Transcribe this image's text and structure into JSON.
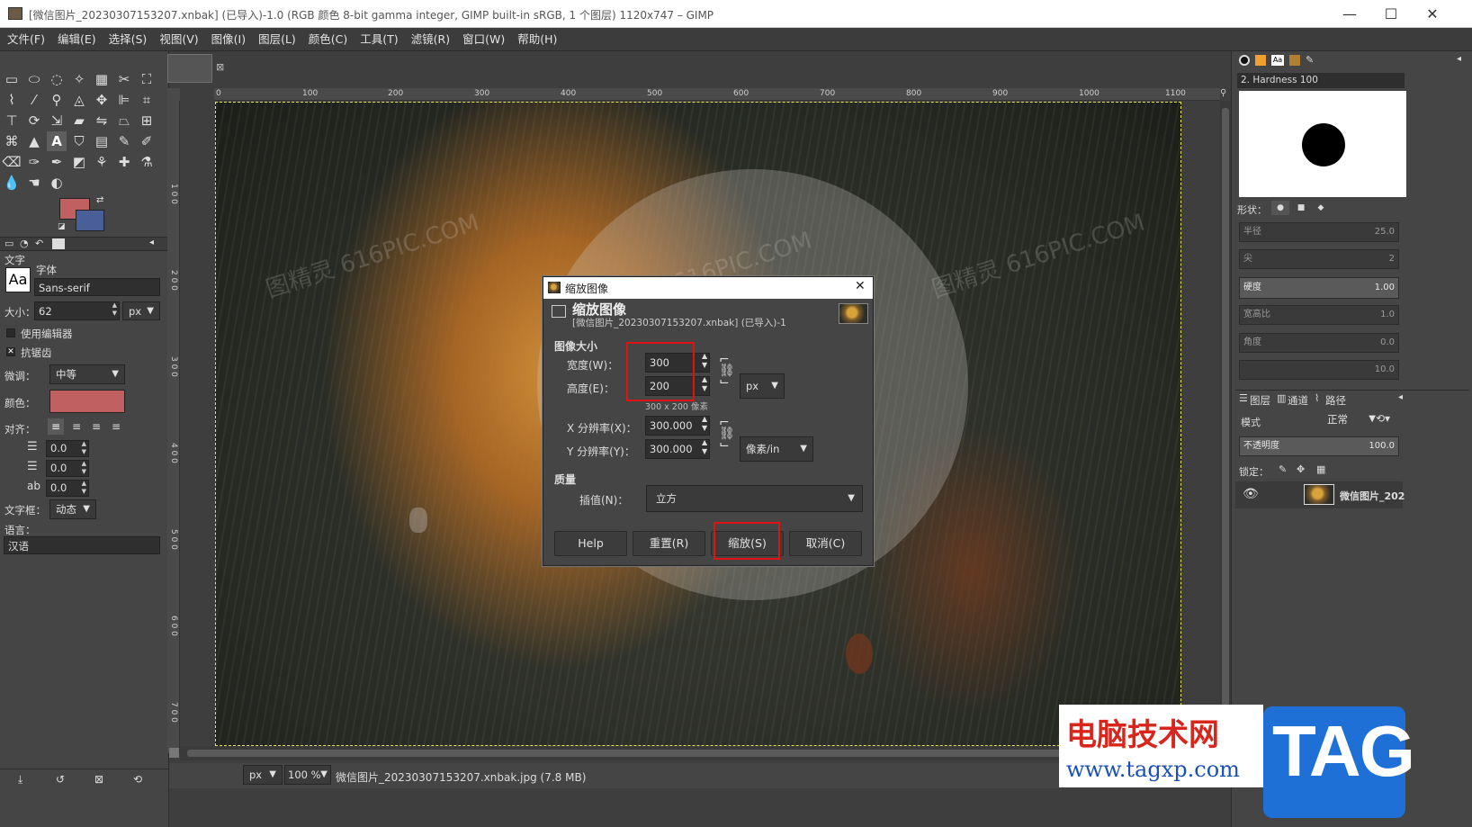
{
  "window": {
    "title": "[微信图片_20230307153207.xnbak] (已导入)-1.0 (RGB 颜色 8-bit gamma integer, GIMP built-in sRGB, 1 个图层) 1120x747 – GIMP",
    "minimize": "—",
    "maximize": "☐",
    "close": "✕"
  },
  "menu": [
    "文件(F)",
    "编辑(E)",
    "选择(S)",
    "视图(V)",
    "图像(I)",
    "图层(L)",
    "颜色(C)",
    "工具(T)",
    "滤镜(R)",
    "窗口(W)",
    "帮助(H)"
  ],
  "toolbox": {
    "fg_color": "#c06060",
    "bg_color": "#4a5f97",
    "section": "文字",
    "font_label": "字体",
    "font_preview": "Aa",
    "font_value": "Sans-serif",
    "size_label": "大小：",
    "size_value": "62",
    "size_unit": "px",
    "use_editor": "使用编辑器",
    "antialias": "抗锯齿",
    "hinting_label": "微调：",
    "hinting_value": "中等",
    "color_label": "颜色：",
    "text_color": "#c06060",
    "justify_label": "对齐：",
    "indent": "0.0",
    "line_spacing": "0.0",
    "letter_spacing": "0.0",
    "box_label": "文字框：",
    "box_value": "动态",
    "lang_label": "语言：",
    "lang_value": "汉语"
  },
  "canvas": {
    "ruler_ticks": [
      "0",
      "100",
      "200",
      "300",
      "400",
      "500",
      "600",
      "700",
      "800",
      "900",
      "1000",
      "1100"
    ],
    "left_ticks": [
      "1 0 0",
      "2 0 0",
      "3 0 0",
      "4 0 0",
      "5 0 0",
      "6 0 0",
      "7 0 0"
    ],
    "watermark": "图精灵 616PIC.COM"
  },
  "status": {
    "unit": "px",
    "zoom": "100 %",
    "filename": "微信图片_20230307153207.xnbak.jpg (7.8 MB)"
  },
  "dialog": {
    "window_title": "缩放图像",
    "close": "✕",
    "header_title": "缩放图像",
    "header_sub": "[微信图片_20230307153207.xnbak] (已导入)-1",
    "image_size_label": "图像大小",
    "width_label": "宽度(W)：",
    "width_value": "300",
    "height_label": "高度(E)：",
    "height_value": "200",
    "size_unit": "px",
    "size_info": "300 x 200 像素",
    "xres_label": "X 分辨率(X)：",
    "xres_value": "300.000",
    "yres_label": "Y 分辨率(Y)：",
    "yres_value": "300.000",
    "res_unit": "像素/in",
    "quality_label": "质量",
    "interp_label": "插值(N)：",
    "interp_value": "立方",
    "buttons": {
      "help": "Help",
      "reset": "重置(R)",
      "scale": "缩放(S)",
      "cancel": "取消(C)"
    }
  },
  "right_panel": {
    "brush_name": "2. Hardness 100",
    "shape_label": "形状：",
    "hardness_label": "硬度",
    "hardness_value": "1.00",
    "faded": [
      {
        "label": "半径",
        "value": "25.0"
      },
      {
        "label": "尖",
        "value": "2"
      },
      {
        "label": "宽高比",
        "value": "1.0"
      },
      {
        "label": "角度",
        "value": "0.0"
      },
      {
        "label": "",
        "value": "10.0"
      }
    ],
    "tabs": [
      "图层",
      "通道",
      "路径"
    ],
    "mode_label": "模式",
    "mode_value": "正常",
    "opacity_label": "不透明度",
    "opacity_value": "100.0",
    "lock_label": "锁定：",
    "layer_name": "微信图片_202"
  },
  "promo": {
    "site_name": "电脑技术网",
    "url": "www.tagxp.com",
    "tag": "TAG"
  }
}
